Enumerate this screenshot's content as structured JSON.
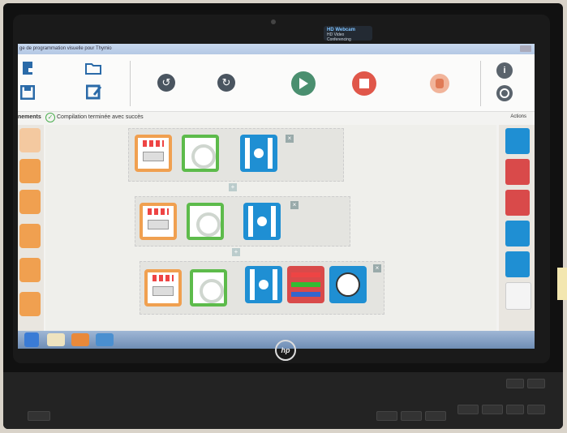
{
  "window": {
    "title": "ge de programmation visuelle pour Thymio"
  },
  "webcam": {
    "title": "HD Webcam",
    "subtitle": "HD Video Conferencing"
  },
  "status": {
    "events_label": "nements",
    "message": "Compilation terminée avec succès",
    "actions_label": "Actions"
  },
  "brand": {
    "logo": "hp"
  },
  "colors": {
    "run": "#4a8f6f",
    "stop": "#e0574a",
    "event": "#f0a050",
    "motor": "#1f8fd3",
    "green": "#5dbb4b"
  },
  "icons": [
    "new-file-icon",
    "open-folder-icon",
    "save-icon",
    "save-as-icon",
    "undo-icon",
    "redo-icon",
    "run-icon",
    "stop-icon",
    "advanced-mode-icon",
    "info-icon",
    "screenshot-icon"
  ]
}
